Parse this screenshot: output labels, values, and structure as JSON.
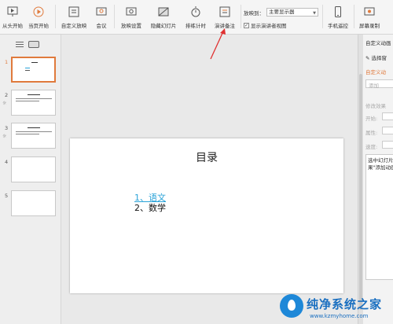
{
  "ribbon": {
    "buttons": [
      {
        "label": "从头开始",
        "icon": "play-from-start-icon"
      },
      {
        "label": "当页开始",
        "icon": "play-current-icon"
      },
      {
        "label": "自定义放映",
        "icon": "custom-show-icon"
      },
      {
        "label": "会议",
        "icon": "meeting-icon"
      },
      {
        "label": "放映设置",
        "icon": "show-settings-icon"
      },
      {
        "label": "隐藏幻灯片",
        "icon": "hide-slide-icon"
      },
      {
        "label": "排练计时",
        "icon": "rehearse-timing-icon"
      },
      {
        "label": "演讲备注",
        "icon": "speaker-notes-icon"
      },
      {
        "label": "手机遥控",
        "icon": "phone-remote-icon"
      },
      {
        "label": "屏幕录制",
        "icon": "screen-record-icon"
      }
    ],
    "play_to_label": "放映到：",
    "play_to_value": "主要显示器",
    "presenter_view_label": "显示演讲者视图",
    "presenter_view_checked": "✓"
  },
  "thumbnails": [
    {
      "num": "1",
      "star": ""
    },
    {
      "num": "2",
      "star": "☼"
    },
    {
      "num": "3",
      "star": "☼"
    },
    {
      "num": "4",
      "star": ""
    },
    {
      "num": "5",
      "star": ""
    }
  ],
  "slide": {
    "title": "目录",
    "item1": "1、语文",
    "item2": "2、数学"
  },
  "right_panel": {
    "header": "自定义动画",
    "select_label": "选择窗",
    "custom_anim": "自定义动",
    "add_button": "添加",
    "modify_effect": "修改效果",
    "start": "开始:",
    "property": "属性:",
    "speed": "速度:",
    "hint": "选中幻灯片中的元素，然后单击\"添加效果\"添加动画"
  },
  "watermark": {
    "title": "纯净系统之家",
    "url": "www.kzmyhome.com"
  },
  "colors": {
    "accent": "#e07a3c",
    "link": "#2aa3d8",
    "arrow": "#e03030"
  }
}
